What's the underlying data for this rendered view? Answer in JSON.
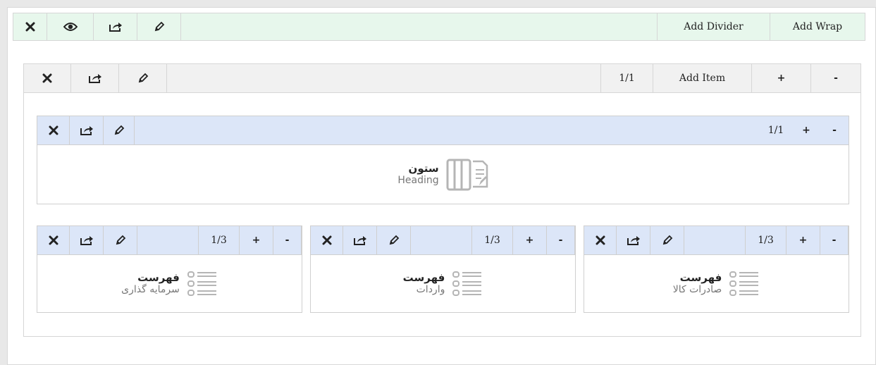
{
  "toolbar": {
    "icons": [
      "close-icon",
      "eye-icon",
      "share-icon",
      "pencil-icon"
    ],
    "add_divider": "Add Divider",
    "add_wrap": "Add Wrap"
  },
  "panel": {
    "count": "1/1",
    "add_item": "Add Item",
    "plus": "+",
    "minus": "-"
  },
  "heading_box": {
    "count": "1/1",
    "plus": "+",
    "minus": "-",
    "name": "ستون",
    "sub": "Heading"
  },
  "list_boxes": [
    {
      "count": "1/3",
      "plus": "+",
      "minus": "-",
      "name": "فهرست",
      "sub": "سرمایه گذاری"
    },
    {
      "count": "1/3",
      "plus": "+",
      "minus": "-",
      "name": "فهرست",
      "sub": "واردات"
    },
    {
      "count": "1/3",
      "plus": "+",
      "minus": "-",
      "name": "فهرست",
      "sub": "صادرات کالا"
    }
  ],
  "colors": {
    "top_bar": "#e7f7ec",
    "panel_bar": "#f1f1f1",
    "box_bar": "#dce6f8",
    "highlight": "#f9f502"
  }
}
